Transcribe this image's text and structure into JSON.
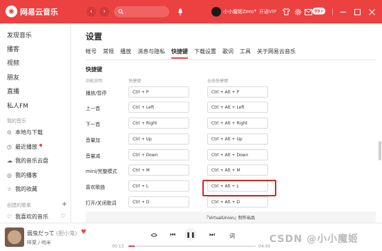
{
  "app": {
    "logo_glyph": "◉",
    "name": "网易云音乐",
    "brand_color": "#ec4141"
  },
  "topbar": {
    "back_glyph": "‹",
    "forward_glyph": "›",
    "search_placeholder": "",
    "mic_glyph": "🎤",
    "username": "小小魔姬Zero",
    "vip_label": "开通VIP",
    "badge_text": "99+",
    "icons": [
      "shirt-icon",
      "gear-icon",
      "mail-icon"
    ]
  },
  "sidebar": {
    "main_items": [
      "发现音乐",
      "播客",
      "视频",
      "朋友",
      "直播",
      "私人FM"
    ],
    "my_music_header": "我的音乐",
    "my_items": [
      {
        "icon": "download-icon",
        "glyph": "⊙",
        "label": "本地与下载"
      },
      {
        "icon": "clock-icon",
        "glyph": "◷",
        "label": "最近播放"
      },
      {
        "icon": "cloud-icon",
        "glyph": "☁",
        "label": "我的音乐云盘"
      },
      {
        "icon": "podcast-icon",
        "glyph": "◎",
        "label": "我的播客"
      },
      {
        "icon": "star-icon",
        "glyph": "☆",
        "label": "我的收藏"
      }
    ],
    "playlists_header": "创建的歌单",
    "liked_playlist": "我喜欢的音乐"
  },
  "settings": {
    "title": "设置",
    "tabs": [
      "帐号",
      "常规",
      "播放",
      "消息与隐私",
      "快捷键",
      "下载设置",
      "歌词",
      "工具",
      "关于网易云音乐"
    ],
    "active_tab": "快捷键",
    "section_title": "快捷键",
    "col_function": "功能说明",
    "col_shortcut": "快捷键",
    "col_global": "全局快捷键",
    "rows": [
      {
        "label": "播放/暂停",
        "local": "Ctrl + P",
        "global": "Ctrl + Alt + P"
      },
      {
        "label": "上一首",
        "local": "Ctrl + Left",
        "global": "Ctrl + Alt + Left"
      },
      {
        "label": "下一首",
        "local": "Ctrl + Right",
        "global": "Ctrl + Alt + Right"
      },
      {
        "label": "音量加",
        "local": "Ctrl + Up",
        "global": "Ctrl + Alt + Up"
      },
      {
        "label": "音量减",
        "local": "Ctrl + Down",
        "global": "Ctrl + Alt + Down"
      },
      {
        "label": "mini/完整模式",
        "local": "Ctrl + M",
        "global": "Ctrl + Alt + M"
      },
      {
        "label": "喜欢歌曲",
        "local": "Ctrl + L",
        "global": "Ctrl + Alt + L"
      },
      {
        "label": "打开/关闭歌词",
        "local": "Ctrl + D",
        "global": "Ctrl + Alt + D"
      }
    ],
    "footer_text": "『VirtualUnion』制作出品"
  },
  "player": {
    "song_title": "弱虫だって",
    "song_alt": "(胆小鬼)",
    "artist": "咩栗 / 呜米",
    "current_time": "00:13",
    "total_time": "04:40",
    "progress": 0.05,
    "play_glyph": "❚❚",
    "prev_glyph": "⏮",
    "next_glyph": "⏭"
  },
  "watermark": "CSDN @小小魔姬"
}
